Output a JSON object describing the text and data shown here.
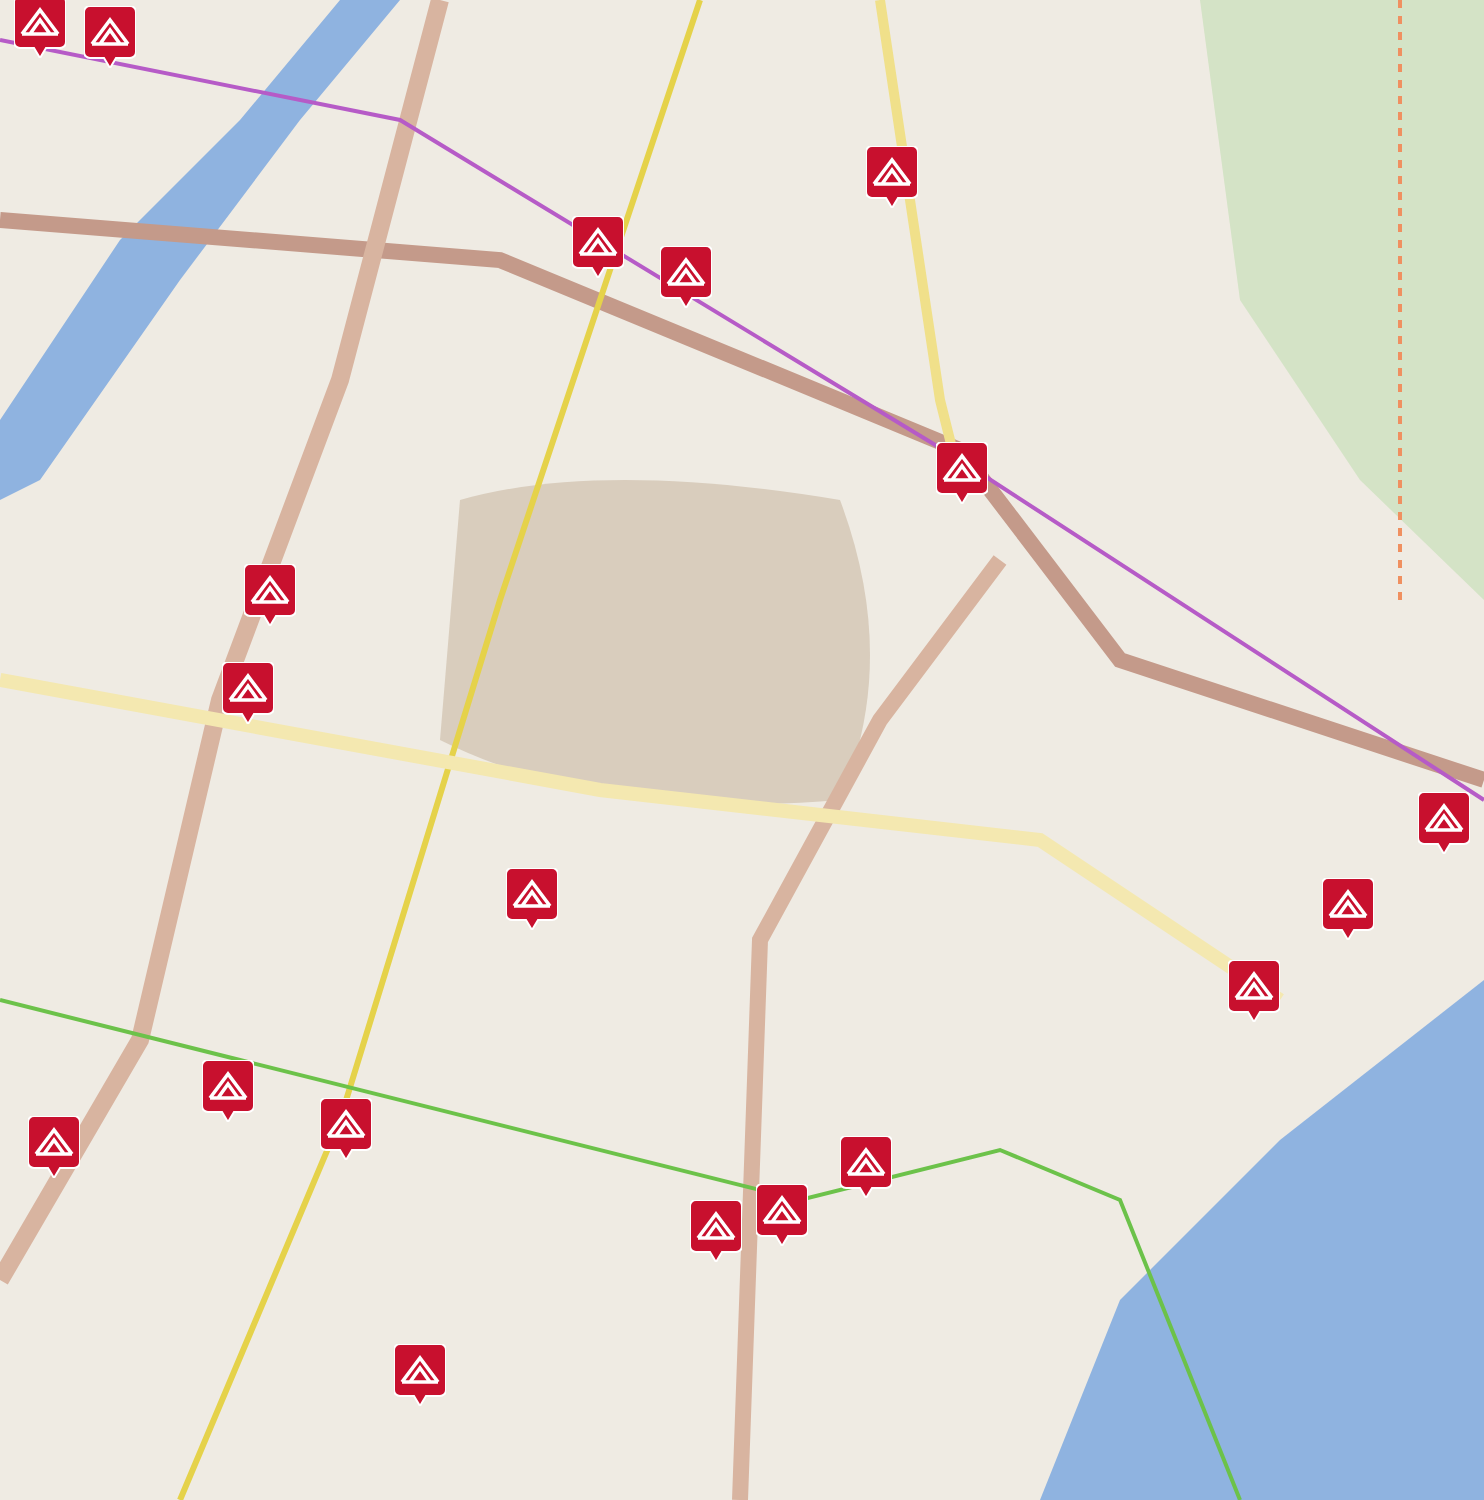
{
  "map": {
    "markers": [
      {
        "kind": "pin"
      },
      {
        "kind": "pin"
      },
      {
        "kind": "pin"
      },
      {
        "kind": "pin"
      },
      {
        "kind": "pin"
      },
      {
        "kind": "pin"
      },
      {
        "kind": "pin"
      },
      {
        "kind": "pin"
      },
      {
        "kind": "pin"
      },
      {
        "kind": "pin"
      },
      {
        "kind": "pin"
      },
      {
        "kind": "pin"
      },
      {
        "kind": "pin"
      },
      {
        "kind": "pin"
      },
      {
        "kind": "pin"
      },
      {
        "kind": "pin"
      },
      {
        "kind": "pin"
      },
      {
        "kind": "pin"
      },
      {
        "kind": "pin"
      }
    ]
  }
}
